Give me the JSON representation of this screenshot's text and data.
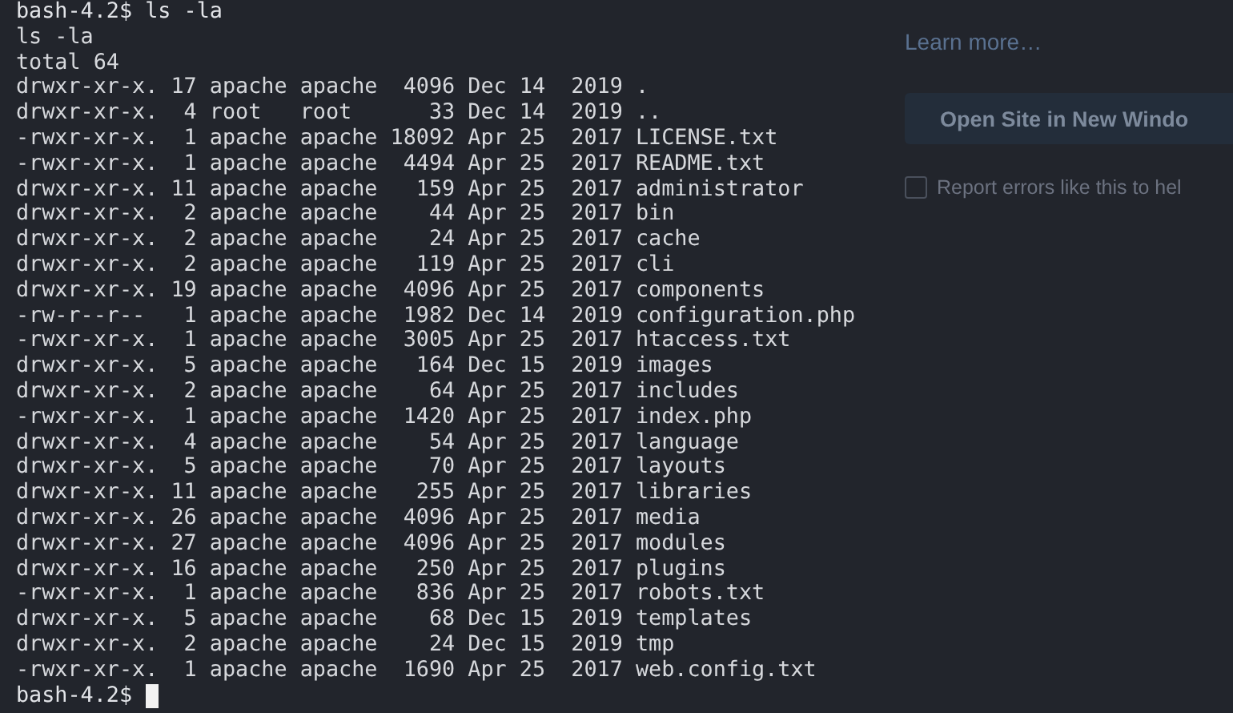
{
  "terminal": {
    "lines": [
      {
        "kind": "prompt",
        "text": "bash-4.2$ ls -la",
        "cursor": false
      },
      {
        "kind": "output",
        "text": "ls -la"
      },
      {
        "kind": "output",
        "text": "total 64"
      },
      {
        "kind": "output",
        "text": "drwxr-xr-x. 17 apache apache  4096 Dec 14  2019 ."
      },
      {
        "kind": "output",
        "text": "drwxr-xr-x.  4 root   root      33 Dec 14  2019 .."
      },
      {
        "kind": "output",
        "text": "-rwxr-xr-x.  1 apache apache 18092 Apr 25  2017 LICENSE.txt"
      },
      {
        "kind": "output",
        "text": "-rwxr-xr-x.  1 apache apache  4494 Apr 25  2017 README.txt"
      },
      {
        "kind": "output",
        "text": "drwxr-xr-x. 11 apache apache   159 Apr 25  2017 administrator"
      },
      {
        "kind": "output",
        "text": "drwxr-xr-x.  2 apache apache    44 Apr 25  2017 bin"
      },
      {
        "kind": "output",
        "text": "drwxr-xr-x.  2 apache apache    24 Apr 25  2017 cache"
      },
      {
        "kind": "output",
        "text": "drwxr-xr-x.  2 apache apache   119 Apr 25  2017 cli"
      },
      {
        "kind": "output",
        "text": "drwxr-xr-x. 19 apache apache  4096 Apr 25  2017 components"
      },
      {
        "kind": "output",
        "text": "-rw-r--r--   1 apache apache  1982 Dec 14  2019 configuration.php"
      },
      {
        "kind": "output",
        "text": "-rwxr-xr-x.  1 apache apache  3005 Apr 25  2017 htaccess.txt"
      },
      {
        "kind": "output",
        "text": "drwxr-xr-x.  5 apache apache   164 Dec 15  2019 images"
      },
      {
        "kind": "output",
        "text": "drwxr-xr-x.  2 apache apache    64 Apr 25  2017 includes"
      },
      {
        "kind": "output",
        "text": "-rwxr-xr-x.  1 apache apache  1420 Apr 25  2017 index.php"
      },
      {
        "kind": "output",
        "text": "drwxr-xr-x.  4 apache apache    54 Apr 25  2017 language"
      },
      {
        "kind": "output",
        "text": "drwxr-xr-x.  5 apache apache    70 Apr 25  2017 layouts"
      },
      {
        "kind": "output",
        "text": "drwxr-xr-x. 11 apache apache   255 Apr 25  2017 libraries"
      },
      {
        "kind": "output",
        "text": "drwxr-xr-x. 26 apache apache  4096 Apr 25  2017 media"
      },
      {
        "kind": "output",
        "text": "drwxr-xr-x. 27 apache apache  4096 Apr 25  2017 modules"
      },
      {
        "kind": "output",
        "text": "drwxr-xr-x. 16 apache apache   250 Apr 25  2017 plugins"
      },
      {
        "kind": "output",
        "text": "-rwxr-xr-x.  1 apache apache   836 Apr 25  2017 robots.txt"
      },
      {
        "kind": "output",
        "text": "drwxr-xr-x.  5 apache apache    68 Dec 15  2019 templates"
      },
      {
        "kind": "output",
        "text": "drwxr-xr-x.  2 apache apache    24 Dec 15  2019 tmp"
      },
      {
        "kind": "output",
        "text": "-rwxr-xr-x.  1 apache apache  1690 Apr 25  2017 web.config.txt"
      },
      {
        "kind": "prompt",
        "text": "bash-4.2$ ",
        "cursor": true
      }
    ]
  },
  "background_page": {
    "link": "Learn more…",
    "button": "Open Site in New Windo",
    "report": {
      "label": "Report errors like this to hel",
      "checked": false
    }
  }
}
